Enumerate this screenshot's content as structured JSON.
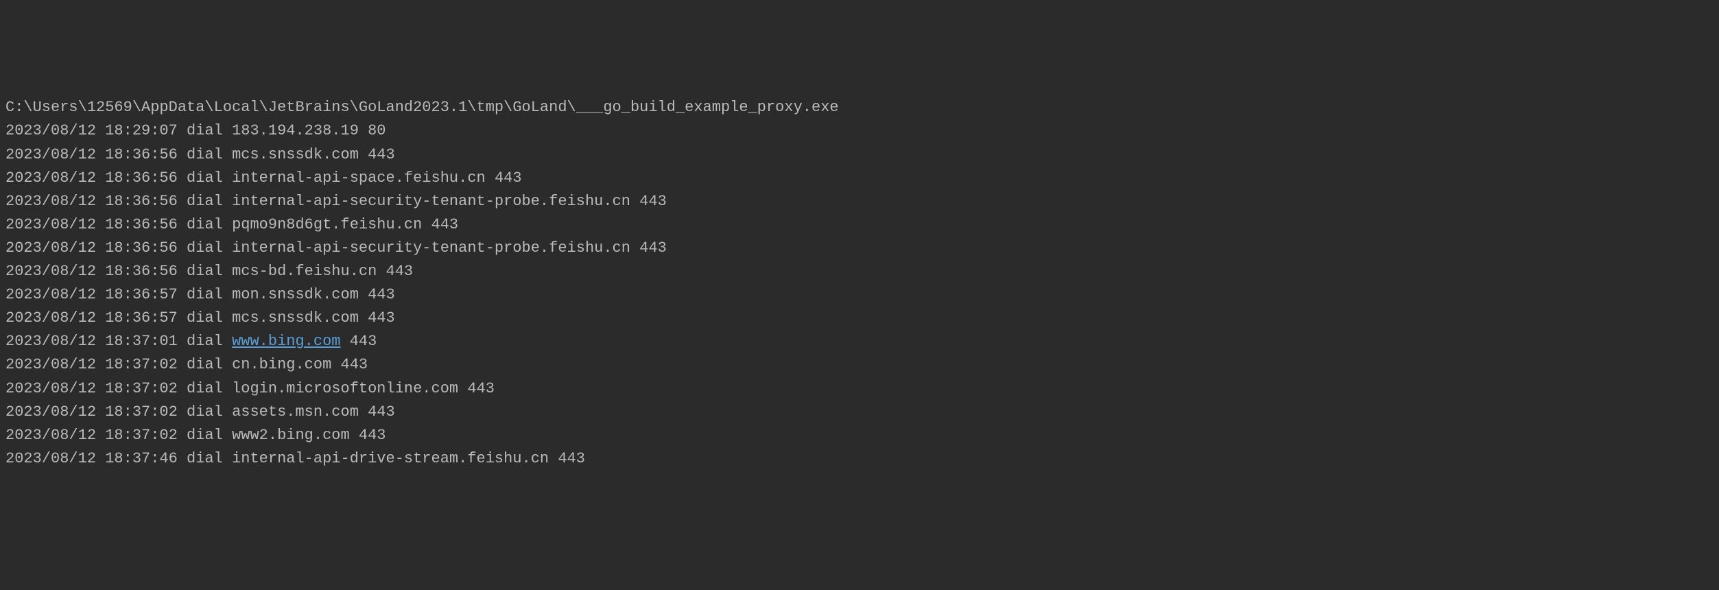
{
  "header": "C:\\Users\\12569\\AppData\\Local\\JetBrains\\GoLand2023.1\\tmp\\GoLand\\___go_build_example_proxy.exe",
  "logs": [
    {
      "timestamp": "2023/08/12 18:29:07",
      "action": "dial",
      "host": "183.194.238.19",
      "port": "80",
      "is_link": false
    },
    {
      "timestamp": "2023/08/12 18:36:56",
      "action": "dial",
      "host": "mcs.snssdk.com",
      "port": "443",
      "is_link": false
    },
    {
      "timestamp": "2023/08/12 18:36:56",
      "action": "dial",
      "host": "internal-api-space.feishu.cn",
      "port": "443",
      "is_link": false
    },
    {
      "timestamp": "2023/08/12 18:36:56",
      "action": "dial",
      "host": "internal-api-security-tenant-probe.feishu.cn",
      "port": "443",
      "is_link": false
    },
    {
      "timestamp": "2023/08/12 18:36:56",
      "action": "dial",
      "host": "pqmo9n8d6gt.feishu.cn",
      "port": "443",
      "is_link": false
    },
    {
      "timestamp": "2023/08/12 18:36:56",
      "action": "dial",
      "host": "internal-api-security-tenant-probe.feishu.cn",
      "port": "443",
      "is_link": false
    },
    {
      "timestamp": "2023/08/12 18:36:56",
      "action": "dial",
      "host": "mcs-bd.feishu.cn",
      "port": "443",
      "is_link": false
    },
    {
      "timestamp": "2023/08/12 18:36:57",
      "action": "dial",
      "host": "mon.snssdk.com",
      "port": "443",
      "is_link": false
    },
    {
      "timestamp": "2023/08/12 18:36:57",
      "action": "dial",
      "host": "mcs.snssdk.com",
      "port": "443",
      "is_link": false
    },
    {
      "timestamp": "2023/08/12 18:37:01",
      "action": "dial",
      "host": "www.bing.com",
      "port": "443",
      "is_link": true
    },
    {
      "timestamp": "2023/08/12 18:37:02",
      "action": "dial",
      "host": "cn.bing.com",
      "port": "443",
      "is_link": false
    },
    {
      "timestamp": "2023/08/12 18:37:02",
      "action": "dial",
      "host": "login.microsoftonline.com",
      "port": "443",
      "is_link": false
    },
    {
      "timestamp": "2023/08/12 18:37:02",
      "action": "dial",
      "host": "assets.msn.com",
      "port": "443",
      "is_link": false
    },
    {
      "timestamp": "2023/08/12 18:37:02",
      "action": "dial",
      "host": "www2.bing.com",
      "port": "443",
      "is_link": false
    },
    {
      "timestamp": "2023/08/12 18:37:46",
      "action": "dial",
      "host": "internal-api-drive-stream.feishu.cn",
      "port": "443",
      "is_link": false
    }
  ]
}
